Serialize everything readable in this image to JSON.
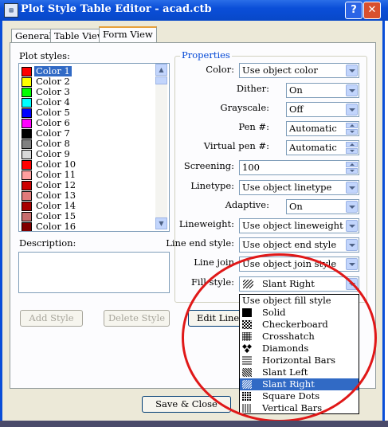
{
  "window": {
    "title": "Plot Style Table Editor - acad.ctb"
  },
  "title_buttons": {
    "help": "?",
    "close": "✕"
  },
  "tabs": [
    {
      "label": "General"
    },
    {
      "label": "Table View"
    },
    {
      "label": "Form View"
    }
  ],
  "plot_styles": {
    "label": "Plot styles:",
    "items": [
      {
        "name": "Color 1",
        "color": "#ff0000"
      },
      {
        "name": "Color 2",
        "color": "#ffff00"
      },
      {
        "name": "Color 3",
        "color": "#00ff00"
      },
      {
        "name": "Color 4",
        "color": "#00ffff"
      },
      {
        "name": "Color 5",
        "color": "#0000ff"
      },
      {
        "name": "Color 6",
        "color": "#ff00ff"
      },
      {
        "name": "Color 7",
        "color": "#000000"
      },
      {
        "name": "Color 8",
        "color": "#808080"
      },
      {
        "name": "Color 9",
        "color": "#d8d8d8"
      },
      {
        "name": "Color 10",
        "color": "#ff0000"
      },
      {
        "name": "Color 11",
        "color": "#ff9f9f"
      },
      {
        "name": "Color 12",
        "color": "#cc0000"
      },
      {
        "name": "Color 13",
        "color": "#e07a7a"
      },
      {
        "name": "Color 14",
        "color": "#a80000"
      },
      {
        "name": "Color 15",
        "color": "#c86e6e"
      },
      {
        "name": "Color 16",
        "color": "#800000"
      }
    ]
  },
  "description": {
    "label": "Description:"
  },
  "buttons": {
    "add_style": "Add Style",
    "delete_style": "Delete Style",
    "edit_lineweights": "Edit Linewe",
    "save_close": "Save & Close"
  },
  "properties": {
    "title": "Properties",
    "color": {
      "label": "Color:",
      "value": "Use object color"
    },
    "dither": {
      "label": "Dither:",
      "value": "On"
    },
    "grayscale": {
      "label": "Grayscale:",
      "value": "Off"
    },
    "pen": {
      "label": "Pen #:",
      "value": "Automatic"
    },
    "virtual_pen": {
      "label": "Virtual pen #:",
      "value": "Automatic"
    },
    "screening": {
      "label": "Screening:",
      "value": "100"
    },
    "linetype": {
      "label": "Linetype:",
      "value": "Use object linetype"
    },
    "adaptive": {
      "label": "Adaptive:",
      "value": "On"
    },
    "lineweight": {
      "label": "Lineweight:",
      "value": "Use object lineweight"
    },
    "line_end_style": {
      "label": "Line end style:",
      "value": "Use object end style"
    },
    "line_join": {
      "label": "Line join",
      "value": "Use object join style"
    },
    "fill_style": {
      "label": "Fill style:",
      "value": "Slant Right",
      "value_icon": "slant-right-pattern-icon"
    }
  },
  "fill_dropdown": {
    "options": [
      {
        "label": "Use object fill style",
        "icon": ""
      },
      {
        "label": "Solid",
        "icon": "solid-pattern-icon"
      },
      {
        "label": "Checkerboard",
        "icon": "checkerboard-pattern-icon"
      },
      {
        "label": "Crosshatch",
        "icon": "crosshatch-pattern-icon"
      },
      {
        "label": "Diamonds",
        "icon": "diamonds-pattern-icon"
      },
      {
        "label": "Horizontal Bars",
        "icon": "horizontal-bars-pattern-icon"
      },
      {
        "label": "Slant Left",
        "icon": "slant-left-pattern-icon"
      },
      {
        "label": "Slant Right",
        "icon": "slant-right-pattern-icon"
      },
      {
        "label": "Square Dots",
        "icon": "square-dots-pattern-icon"
      },
      {
        "label": "Vertical Bars",
        "icon": "vertical-bars-pattern-icon"
      }
    ],
    "selected": "Slant Right"
  },
  "colors": {
    "title_bar": "#0a4ed8",
    "selection": "#316ac5",
    "annotation_circle": "#e01818",
    "group_title": "#0046d5"
  }
}
